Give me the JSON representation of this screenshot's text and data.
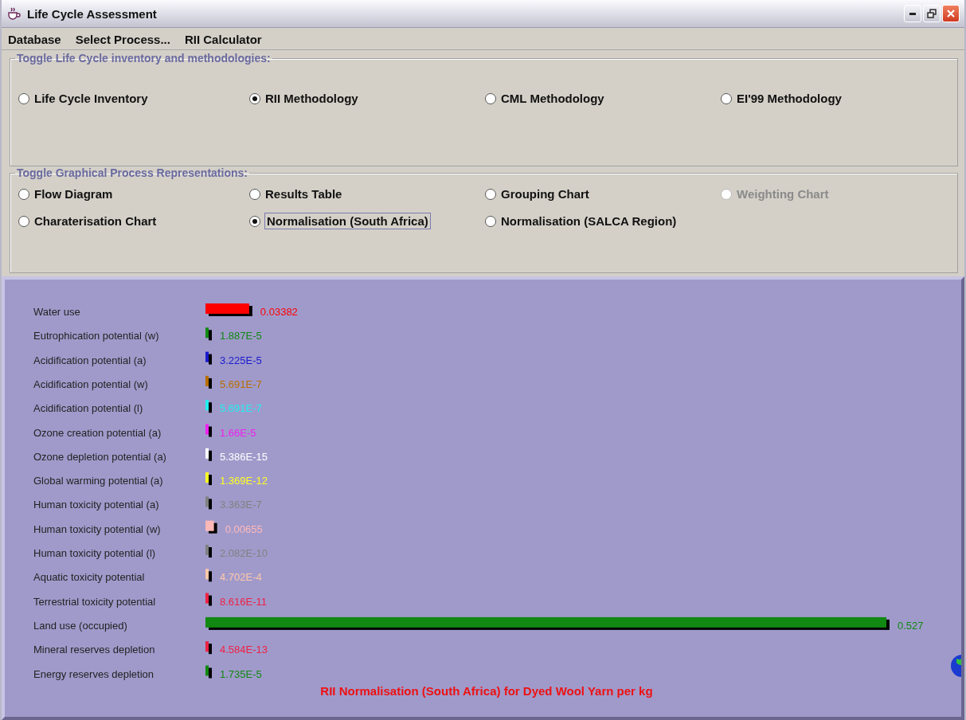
{
  "window": {
    "title": "Life Cycle Assessment"
  },
  "menu": [
    "Database",
    "Select Process...",
    "RII Calculator"
  ],
  "methodology_group": {
    "title": "Toggle Life Cycle inventory and methodologies:",
    "options": [
      {
        "label": "Life Cycle Inventory",
        "selected": false,
        "disabled": false
      },
      {
        "label": "RII Methodology",
        "selected": true,
        "disabled": false
      },
      {
        "label": "CML Methodology",
        "selected": false,
        "disabled": false
      },
      {
        "label": "EI'99 Methodology",
        "selected": false,
        "disabled": false
      }
    ]
  },
  "representation_group": {
    "title": "Toggle Graphical Process Representations:",
    "options": [
      {
        "label": "Flow Diagram",
        "selected": false,
        "disabled": false
      },
      {
        "label": "Results Table",
        "selected": false,
        "disabled": false
      },
      {
        "label": "Grouping Chart",
        "selected": false,
        "disabled": false
      },
      {
        "label": "Weighting Chart",
        "selected": false,
        "disabled": true
      },
      {
        "label": "Charaterisation Chart",
        "selected": false,
        "disabled": false
      },
      {
        "label": "Normalisation (South Africa)",
        "selected": true,
        "disabled": false
      },
      {
        "label": "Normalisation (SALCA Region)",
        "selected": false,
        "disabled": false
      }
    ]
  },
  "chart": {
    "title": "RII Normalisation (South Africa) for Dyed Wool Yarn per kg",
    "bars": [
      {
        "label": "Water use",
        "value": "0.03382",
        "color": "#ff0000"
      },
      {
        "label": "Eutrophication potential (w)",
        "value": "1.887E-5",
        "color": "#118811"
      },
      {
        "label": "Acidification potential (a)",
        "value": "3.225E-5",
        "color": "#1a1acc"
      },
      {
        "label": "Acidification potential (w)",
        "value": "5.691E-7",
        "color": "#b86e00"
      },
      {
        "label": "Acidification potential (l)",
        "value": "5.691E-7",
        "color": "#22eeee"
      },
      {
        "label": "Ozone creation potential (a)",
        "value": "1.66E-5",
        "color": "#ee22ee"
      },
      {
        "label": "Ozone depletion potential (a)",
        "value": "5.386E-15",
        "color": "#ffffff"
      },
      {
        "label": "Global warming potential (a)",
        "value": "1.369E-12",
        "color": "#ffff22"
      },
      {
        "label": "Human toxicity potential (a)",
        "value": "3.363E-7",
        "color": "#808080"
      },
      {
        "label": "Human toxicity potential (w)",
        "value": "0.00655",
        "color": "#ffb8b8"
      },
      {
        "label": "Human toxicity potential (l)",
        "value": "2.082E-10",
        "color": "#808080"
      },
      {
        "label": "Aquatic toxicity potential",
        "value": "4.702E-4",
        "color": "#ffc8a8"
      },
      {
        "label": "Terrestrial toxicity potential",
        "value": "8.616E-11",
        "color": "#ee2244"
      },
      {
        "label": "Land use (occupied)",
        "value": "0.527",
        "color": "#118811"
      },
      {
        "label": "Mineral reserves depletion",
        "value": "4.584E-13",
        "color": "#ee2244"
      },
      {
        "label": "Energy reserves depletion",
        "value": "1.735E-5",
        "color": "#118811"
      }
    ]
  }
}
